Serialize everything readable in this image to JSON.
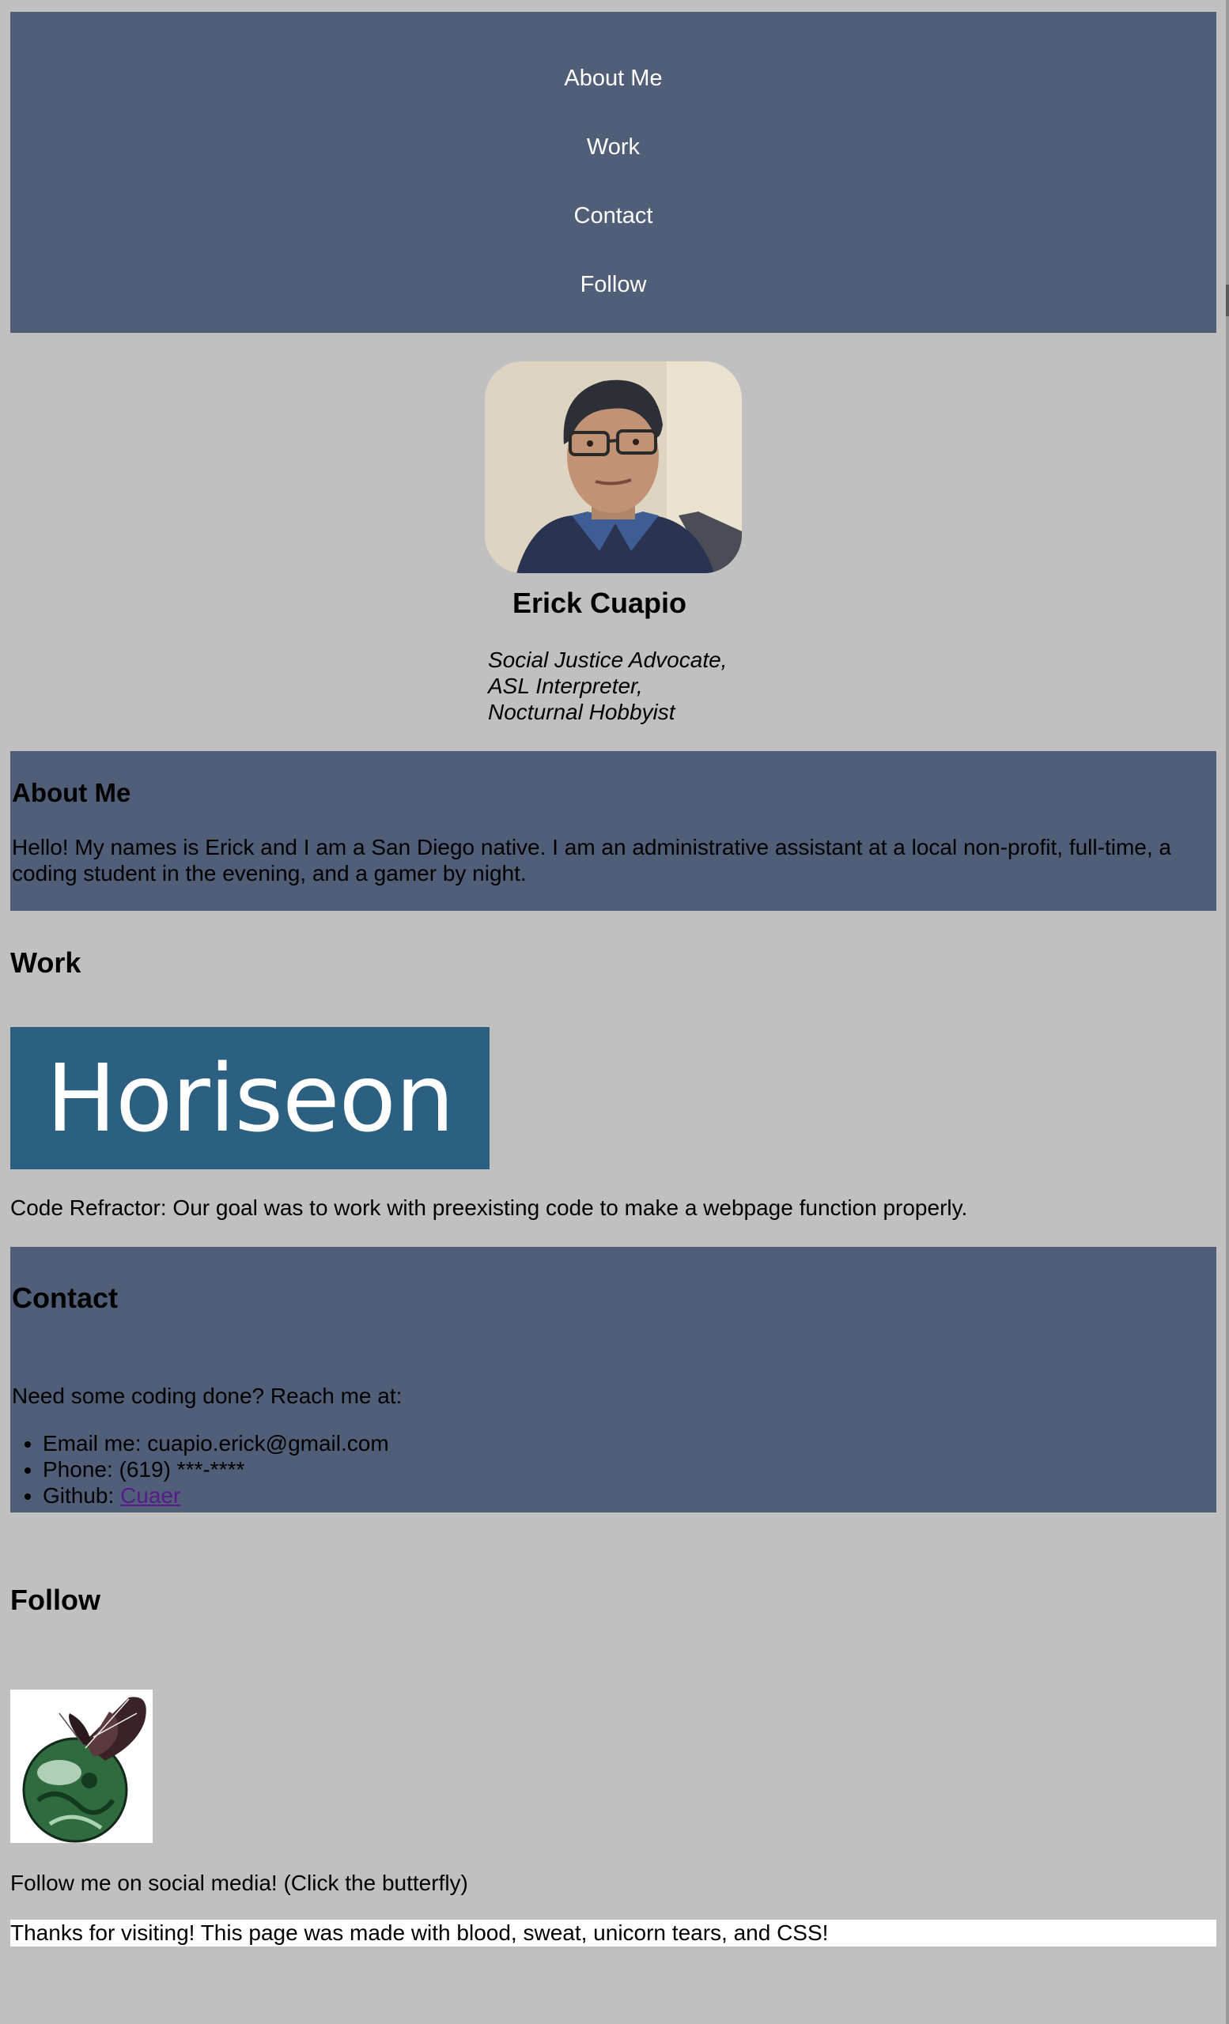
{
  "nav": {
    "items": [
      {
        "label": "About Me"
      },
      {
        "label": "Work"
      },
      {
        "label": "Contact"
      },
      {
        "label": "Follow"
      }
    ]
  },
  "header": {
    "name": "Erick Cuapio",
    "tagline": [
      "Social Justice Advocate,",
      "ASL Interpreter,",
      "Nocturnal Hobbyist"
    ]
  },
  "about": {
    "title": "About Me",
    "text": "Hello! My names is Erick and I am a San Diego native. I am an administrative assistant at a local non-profit, full-time, a coding student in the evening, and a gamer by night."
  },
  "work": {
    "title": "Work",
    "logo_text": "Horiseon",
    "description": "Code Refractor: Our goal was to work with preexisting code to make a webpage function properly."
  },
  "contact": {
    "title": "Contact",
    "intro": "Need some coding done? Reach me at:",
    "email": "Email me: cuapio.erick@gmail.com",
    "phone": "Phone: (619) ***-****",
    "github_label": "Github: ",
    "github_link": "Cuaer"
  },
  "follow": {
    "title": "Follow",
    "description": "Follow me on social media! (Click the butterfly)"
  },
  "footer": {
    "text": "Thanks for visiting! This page was made with blood, sweat, unicorn tears, and CSS!"
  },
  "colors": {
    "page_bg": "#c0c0c0",
    "section_bg": "#505e77",
    "logo_bg": "#2b6080",
    "link_visited": "#551a8b"
  }
}
